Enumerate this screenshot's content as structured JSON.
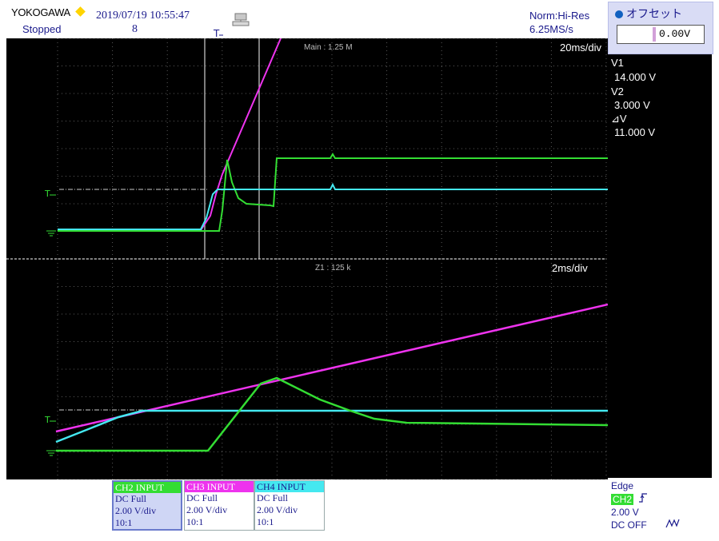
{
  "header": {
    "brand": "YOKOGAWA",
    "datetime": "2019/07/19 10:55:47",
    "status": "Stopped",
    "acq_count": "8",
    "acq_mode": "Norm:Hi-Res",
    "sample_rate": "6.25MS/s"
  },
  "offset_panel": {
    "title": "オフセット",
    "value": "0.00V"
  },
  "main_window": {
    "label": "Main : 1.25 M",
    "time_div": "20ms/div"
  },
  "zoom_window": {
    "label": "Z1 : 125 k",
    "time_div": "2ms/div"
  },
  "cursor_readout": {
    "v1_label": "V1",
    "v1_value": "14.000 V",
    "v2_label": "V2",
    "v2_value": "3.000 V",
    "dv_label": "⊿V",
    "dv_value": "11.000 V"
  },
  "channels": [
    {
      "title": "CH2 INPUT",
      "coupling": "DC Full",
      "scale": "2.00 V/div",
      "probe": "10:1",
      "color": "#33dd33"
    },
    {
      "title": "CH3 INPUT",
      "coupling": "DC Full",
      "scale": "2.00 V/div",
      "probe": "10:1",
      "color": "#ee33ee"
    },
    {
      "title": "CH4 INPUT",
      "coupling": "DC Full",
      "scale": "2.00 V/div",
      "probe": "10:1",
      "color": "#44e8f0"
    }
  ],
  "trigger": {
    "type": "Edge",
    "source": "CH2",
    "level": "2.00 V",
    "hf_reject": "DC OFF"
  },
  "colors": {
    "ch2": "#33dd33",
    "ch3": "#ee33ee",
    "ch4": "#44e8f0",
    "grid": "#5a5a5a"
  },
  "icons": {
    "trigger_position": "trigger-position-icon",
    "network": "network-icon",
    "trigger_level_marker": "trigger-level-marker-icon",
    "ground_marker": "ground-marker-icon",
    "trigger_slope": "rising-edge-icon"
  }
}
